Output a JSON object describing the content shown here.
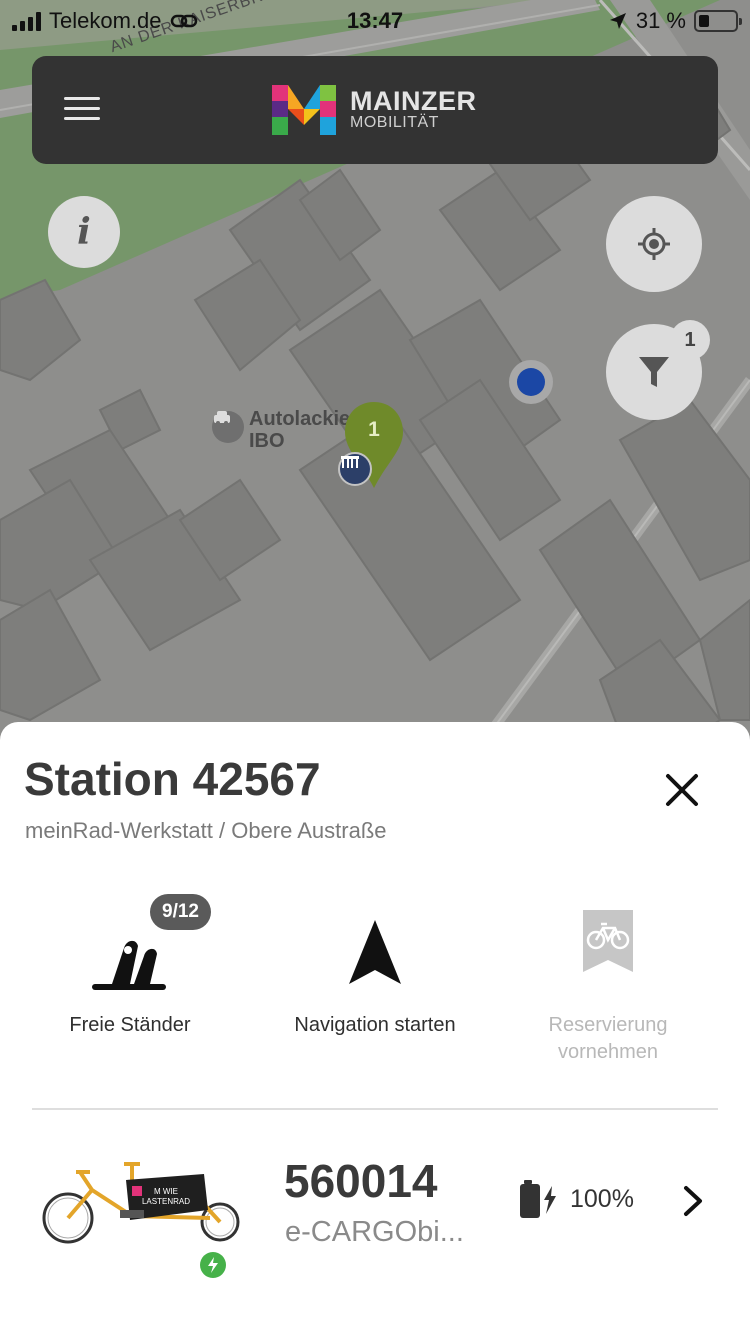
{
  "status_bar": {
    "carrier": "Telekom.de",
    "time": "13:47",
    "battery_pct": "31 %"
  },
  "header": {
    "logo_line1": "MAINZER",
    "logo_line2": "MOBILITÄT",
    "menu_icon": "hamburger-menu-icon"
  },
  "map": {
    "street_label": "AN DER KAISERBRÜCKE",
    "poi_name_line1": "Autolackierei",
    "poi_name_line2": "IBO",
    "cluster_count": "1",
    "filter_count": "1",
    "info_icon": "i",
    "colors": {
      "pin": "#6f8a2a",
      "user_location": "#1b47a5",
      "header_bg": "#333333"
    }
  },
  "station": {
    "title": "Station 42567",
    "subtitle": "meinRad-Werkstatt / Obere Austraße",
    "actions": {
      "free_stands_count": "9/12",
      "free_stands_label": "Freie Ständer",
      "navigate_label": "Navigation starten",
      "reserve_label_line1": "Reservierung",
      "reserve_label_line2": "vornehmen"
    }
  },
  "vehicle": {
    "id": "560014",
    "type": "e-CARGObi...",
    "battery": "100%",
    "bike_brand_text1": "M WIE",
    "bike_brand_text2": "LASTENRAD"
  }
}
